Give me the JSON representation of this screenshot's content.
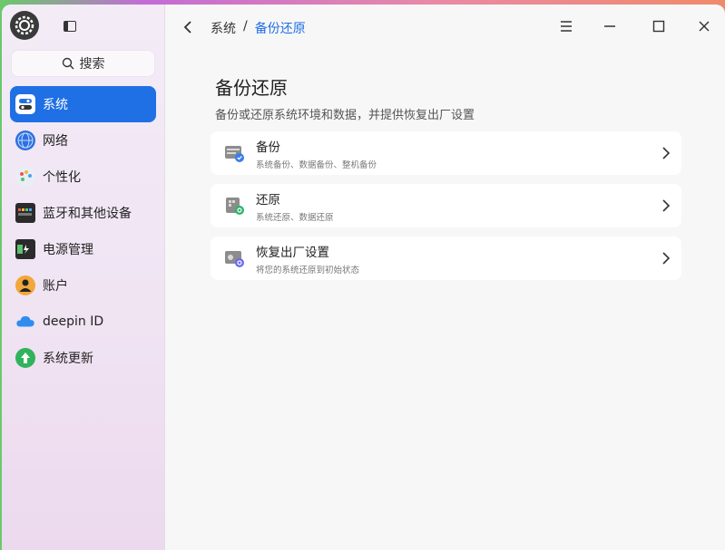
{
  "sidebar": {
    "search_label": "搜索",
    "items": [
      {
        "label": "系统",
        "active": true
      },
      {
        "label": "网络"
      },
      {
        "label": "个性化"
      },
      {
        "label": "蓝牙和其他设备"
      },
      {
        "label": "电源管理"
      },
      {
        "label": "账户"
      },
      {
        "label": "deepin ID"
      },
      {
        "label": "系统更新"
      }
    ]
  },
  "header": {
    "breadcrumb_parent": "系统",
    "breadcrumb_sep": "/",
    "breadcrumb_current": "备份还原"
  },
  "main": {
    "title": "备份还原",
    "subtitle": "备份或还原系统环境和数据，并提供恢复出厂设置",
    "cards": [
      {
        "title": "备份",
        "desc": "系统备份、数据备份、整机备份"
      },
      {
        "title": "还原",
        "desc": "系统还原、数据还原"
      },
      {
        "title": "恢复出厂设置",
        "desc": "将您的系统还原到初始状态"
      }
    ]
  },
  "colors": {
    "accent": "#1f6fe5",
    "sidebar_bg": "#f3ecf7",
    "content_bg": "#f7f7f8"
  }
}
